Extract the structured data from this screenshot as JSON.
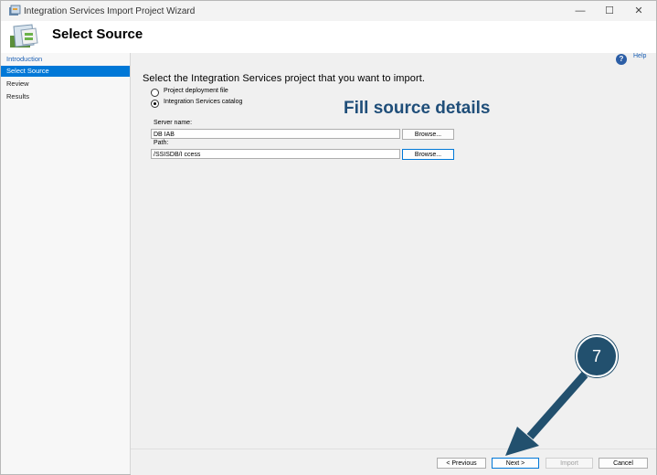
{
  "window": {
    "title": "Integration Services Import Project Wizard",
    "minimize": "—",
    "maximize": "☐",
    "close": "✕"
  },
  "header": {
    "title": "Select Source"
  },
  "sidebar": {
    "items": [
      {
        "label": "Introduction",
        "state": "link"
      },
      {
        "label": "Select Source",
        "state": "active"
      },
      {
        "label": "Review",
        "state": "normal"
      },
      {
        "label": "Results",
        "state": "normal"
      }
    ]
  },
  "help": {
    "icon": "?",
    "label": "Help"
  },
  "main": {
    "instruction": "Select the Integration Services project that you want to import.",
    "options": [
      {
        "label": "Project deployment file",
        "selected": false
      },
      {
        "label": "Integration Services catalog",
        "selected": true
      }
    ],
    "server_label": "Server name:",
    "server_value": "DB        IAB",
    "path_label": "Path:",
    "path_value": "/SSISDB/I                               ccess",
    "browse_label": "Browse..."
  },
  "annotation": {
    "text": "Fill source details",
    "step": "7",
    "color": "#1f4e79"
  },
  "footer": {
    "previous": "< Previous",
    "next": "Next >",
    "import": "Import",
    "cancel": "Cancel"
  }
}
